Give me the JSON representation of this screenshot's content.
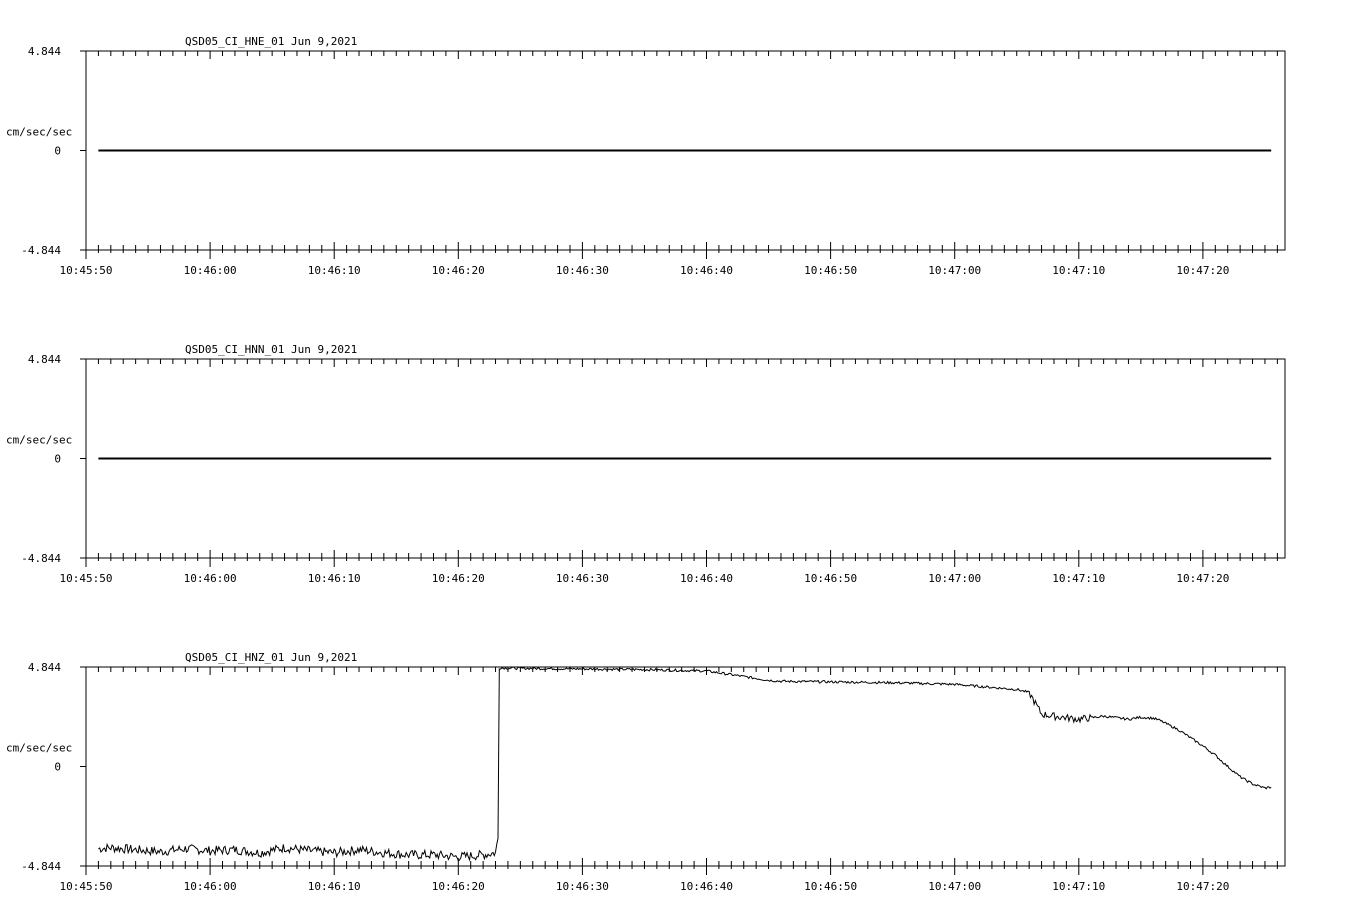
{
  "chart_data": [
    {
      "type": "line",
      "title": "QSD05_CI_HNE_01  Jun 9,2021",
      "ylabel": "cm/sec/sec",
      "ylim": [
        -4.844,
        4.844
      ],
      "y_tick_labels": [
        "4.844",
        "0",
        "-4.844"
      ],
      "x_tick_labels": [
        "10:45:50",
        "10:46:00",
        "10:46:10",
        "10:46:20",
        "10:46:30",
        "10:46:40",
        "10:46:50",
        "10:47:00",
        "10:47:10",
        "10:47:20"
      ],
      "xlim_seconds": [
        0,
        97
      ],
      "grid": false,
      "x": [
        1,
        95.5
      ],
      "y": [
        0,
        0
      ]
    },
    {
      "type": "line",
      "title": "QSD05_CI_HNN_01  Jun 9,2021",
      "ylabel": "cm/sec/sec",
      "ylim": [
        -4.844,
        4.844
      ],
      "y_tick_labels": [
        "4.844",
        "0",
        "-4.844"
      ],
      "x_tick_labels": [
        "10:45:50",
        "10:46:00",
        "10:46:10",
        "10:46:20",
        "10:46:30",
        "10:46:40",
        "10:46:50",
        "10:47:00",
        "10:47:10",
        "10:47:20"
      ],
      "xlim_seconds": [
        0,
        97
      ],
      "grid": false,
      "x": [
        1,
        95.5
      ],
      "y": [
        0,
        0
      ]
    },
    {
      "type": "line",
      "title": "QSD05_CI_HNZ_01  Jun 9,2021",
      "ylabel": "cm/sec/sec",
      "ylim": [
        -4.844,
        4.844
      ],
      "y_tick_labels": [
        "4.844",
        "0",
        "-4.844"
      ],
      "x_tick_labels": [
        "10:45:50",
        "10:46:00",
        "10:46:10",
        "10:46:20",
        "10:46:30",
        "10:46:40",
        "10:46:50",
        "10:47:00",
        "10:47:10",
        "10:47:20"
      ],
      "xlim_seconds": [
        0,
        97
      ],
      "grid": false,
      "x": [
        1,
        2,
        4,
        6,
        8,
        10,
        12,
        14,
        16,
        18,
        20,
        22,
        24,
        26,
        28,
        30,
        31,
        32,
        33,
        33.2,
        33.3,
        35,
        40,
        45,
        50,
        55,
        56,
        60,
        65,
        70,
        75,
        76,
        77,
        78,
        80,
        82,
        84,
        85,
        86,
        86.5,
        87,
        88,
        89,
        90,
        91,
        92,
        93,
        94,
        95,
        95.5
      ],
      "y": [
        -4.0,
        -3.95,
        -4.05,
        -4.15,
        -4.0,
        -4.1,
        -4.05,
        -4.2,
        -3.95,
        -4.1,
        -4.2,
        -4.05,
        -4.2,
        -4.3,
        -4.3,
        -4.4,
        -4.35,
        -4.3,
        -4.2,
        -3.5,
        4.8,
        4.78,
        4.75,
        4.72,
        4.65,
        4.2,
        4.15,
        4.12,
        4.08,
        4.0,
        3.75,
        3.6,
        2.55,
        2.45,
        2.3,
        2.45,
        2.3,
        2.4,
        2.35,
        2.25,
        2.1,
        1.8,
        1.4,
        1.0,
        0.55,
        0.0,
        -0.5,
        -0.85,
        -1.05,
        -1.0
      ]
    }
  ]
}
